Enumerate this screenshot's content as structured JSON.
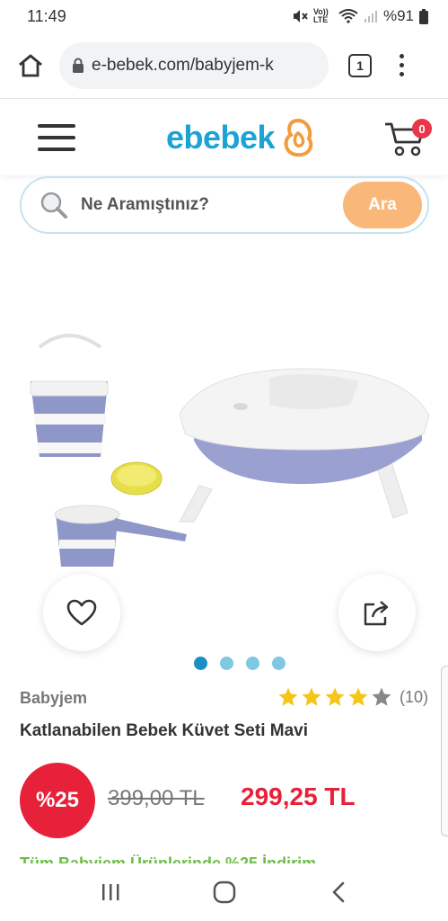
{
  "status_bar": {
    "time": "11:49",
    "battery": "%91",
    "volte_label": "Vo)) LTE"
  },
  "browser": {
    "url": "e-bebek.com/babyjem-k",
    "tab_count": "1"
  },
  "site": {
    "logo": "ebebek",
    "cart_count": "0",
    "brand_color": "#1aa3d4"
  },
  "search": {
    "placeholder": "Ne Aramıştınız?",
    "button": "Ara"
  },
  "product": {
    "brand": "Babyjem",
    "title": "Katlanabilen Bebek Küvet Seti Mavi",
    "rating": 4,
    "rating_max": 5,
    "review_count": "(10)",
    "discount": "%25",
    "old_price": "399,00 TL",
    "new_price": "299,25 TL",
    "promo": "Tüm Babyjem Ürünlerinde %25 İndirim",
    "gallery_count": 4,
    "gallery_active": 0
  },
  "colors": {
    "accent": "#1aa3d4",
    "price_red": "#e8213a",
    "search_button": "#f9b87a",
    "star": "#f5c518"
  }
}
